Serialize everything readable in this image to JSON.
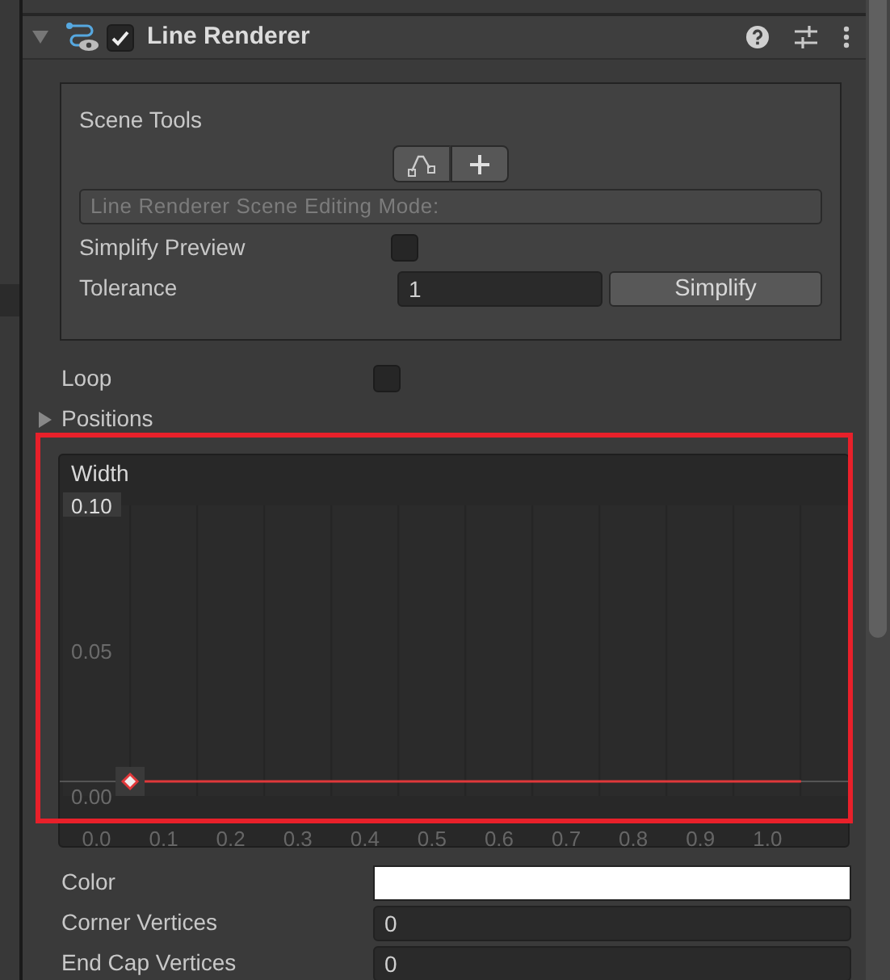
{
  "component": {
    "title": "Line Renderer",
    "expanded": true,
    "enabled": true
  },
  "scene_tools": {
    "title": "Scene Tools",
    "tool_buttons": [
      {
        "kind": "edit-points"
      },
      {
        "kind": "add-points"
      }
    ],
    "mode_label": "Line Renderer Scene Editing Mode:",
    "simplify_preview": {
      "label": "Simplify Preview",
      "checked": false
    },
    "tolerance": {
      "label": "Tolerance",
      "value": "1"
    },
    "simplify_button": "Simplify"
  },
  "loop": {
    "label": "Loop",
    "checked": false
  },
  "positions": {
    "label": "Positions",
    "expanded": false
  },
  "width_curve": {
    "chart_data": {
      "type": "line",
      "title": "Width",
      "x": [
        0.05,
        1.05
      ],
      "xlim": [
        -0.05,
        1.12
      ],
      "ylim": [
        0,
        0.1
      ],
      "ref_lines": [
        {
          "axis": "y",
          "value": 0.005
        }
      ],
      "series": [
        {
          "color": "#e0383a",
          "values": [
            0.005,
            0.005
          ]
        }
      ],
      "xticks": [
        {
          "value": 0,
          "label": "0.0"
        },
        {
          "value": 0.1,
          "label": "0.1"
        },
        {
          "value": 0.2,
          "label": "0.2"
        },
        {
          "value": 0.3,
          "label": "0.3"
        },
        {
          "value": 0.4,
          "label": "0.4"
        },
        {
          "value": 0.5,
          "label": "0.5"
        },
        {
          "value": 0.6,
          "label": "0.6"
        },
        {
          "value": 0.7,
          "label": "0.7"
        },
        {
          "value": 0.8,
          "label": "0.8"
        },
        {
          "value": 0.9,
          "label": "0.9"
        },
        {
          "value": 1,
          "label": "1.0"
        }
      ],
      "yticks": [
        {
          "value": 0.1,
          "label": "0.10"
        },
        {
          "value": 0.05,
          "label": "0.05"
        },
        {
          "value": 0,
          "label": "0.00"
        }
      ]
    }
  },
  "highlight": {
    "color": "#e8202a"
  },
  "fields": [
    {
      "kind": "color",
      "label": "Color",
      "color": "#ffffff"
    },
    {
      "kind": "number",
      "label": "Corner Vertices",
      "value": "0"
    },
    {
      "kind": "number",
      "label": "End Cap Vertices",
      "value": "0"
    }
  ]
}
